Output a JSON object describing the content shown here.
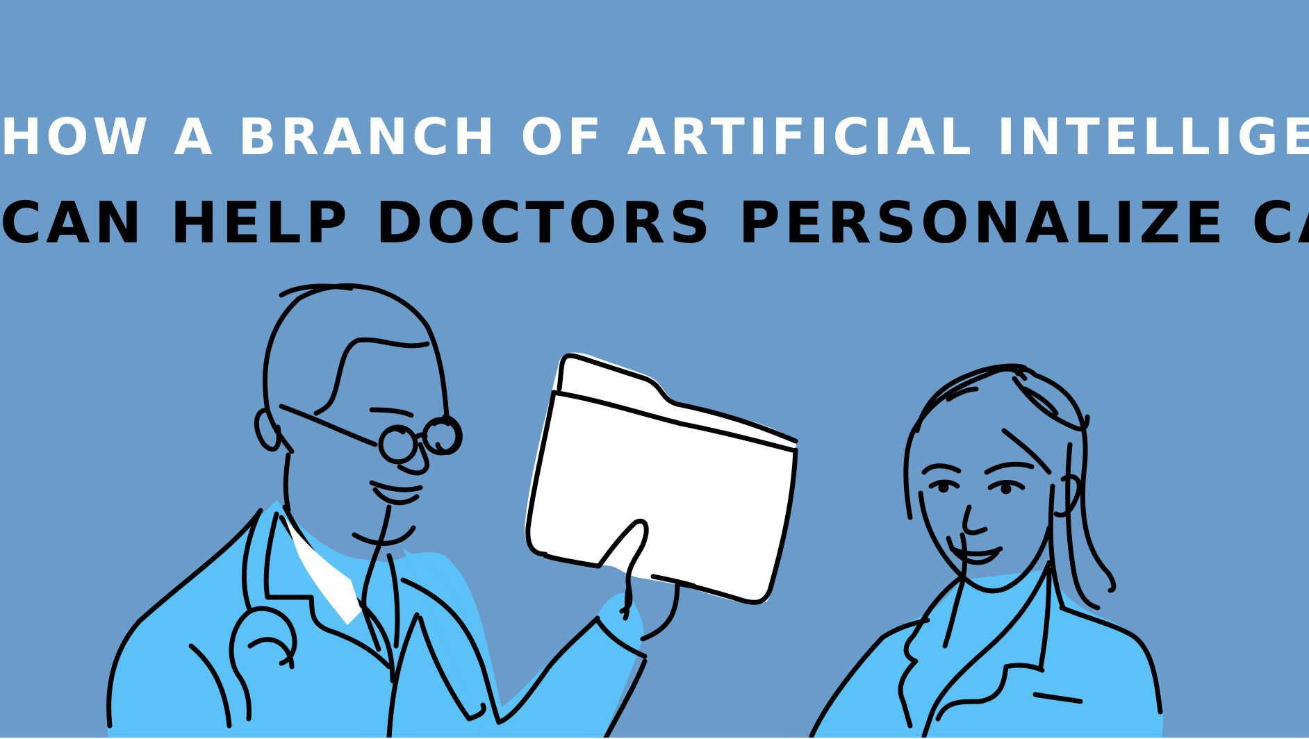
{
  "headline": {
    "line_1": "HOW A BRANCH OF ARTIFICIAL INTELLIGENCE",
    "line_2": "CAN HELP DOCTORS PERSONALIZE CANCER CARE"
  },
  "colors": {
    "background": "#6b9cc9",
    "headline_line_1": "#ffffff",
    "headline_line_2": "#000000",
    "coat": "#5bc1f6",
    "outline": "#000000",
    "folder": "#ffffff"
  },
  "illustration": {
    "figures": [
      "male-doctor",
      "female-doctor"
    ],
    "props": [
      "folder",
      "stethoscope",
      "glasses"
    ]
  }
}
